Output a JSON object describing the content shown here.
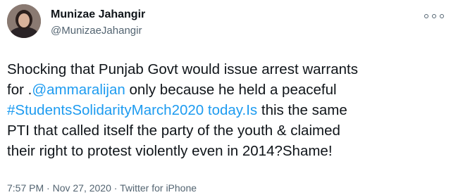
{
  "author": {
    "name": "Munizae Jahangir",
    "handle": "@MunizaeJahangir"
  },
  "tweet": {
    "line1": "Shocking that Punjab Govt would issue arrest warrants",
    "line2_prefix": "for .",
    "mention": "@ammaralijan",
    "line2_suffix": " only because he held a peaceful",
    "hashtag_link": "#StudentsSolidarityMarch2020 today.Is",
    "line3_suffix": " this the same",
    "line4": "PTI that called itself the party of the youth & claimed",
    "line5": "their right to protest violently even in 2014?Shame!"
  },
  "meta": {
    "time": "7:57 PM",
    "date": "Nov 27, 2020",
    "source": "Twitter for iPhone",
    "separator": "·"
  },
  "colors": {
    "link": "#1d9bf0",
    "secondary_text": "#536471",
    "primary_text": "#0f1419"
  },
  "icons": {
    "more": "more-options-icon"
  }
}
